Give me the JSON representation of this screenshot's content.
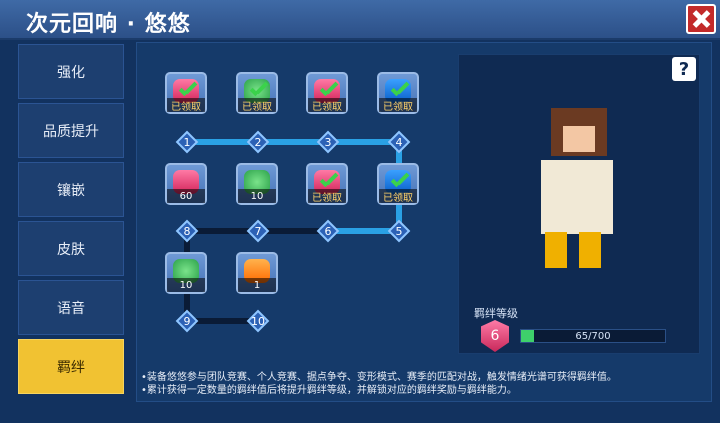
{
  "window": {
    "title": "次元回响 · 悠悠"
  },
  "sidebar": {
    "items": [
      {
        "label": "强化"
      },
      {
        "label": "品质提升"
      },
      {
        "label": "镶嵌"
      },
      {
        "label": "皮肤"
      },
      {
        "label": "语音"
      },
      {
        "label": "羁绊",
        "active": true
      }
    ]
  },
  "rewards": [
    {
      "type": "gem",
      "badge": "已领取",
      "claimed": true
    },
    {
      "type": "clover",
      "badge": "已领取",
      "claimed": true
    },
    {
      "type": "gem",
      "badge": "已领取",
      "claimed": true
    },
    {
      "type": "chest",
      "badge": "已领取",
      "claimed": true
    },
    {
      "type": "gem",
      "badge": "60",
      "claimed": false
    },
    {
      "type": "clover",
      "badge": "10",
      "claimed": false
    },
    {
      "type": "gem",
      "badge": "已领取",
      "claimed": true
    },
    {
      "type": "chest",
      "badge": "已领取",
      "claimed": true
    },
    {
      "type": "clover",
      "badge": "10",
      "claimed": false
    },
    {
      "type": "gift",
      "badge": "1",
      "claimed": false
    }
  ],
  "nodes": [
    "1",
    "2",
    "3",
    "4",
    "5",
    "6",
    "7",
    "8",
    "9",
    "10"
  ],
  "help_button": {
    "label": "?"
  },
  "bond": {
    "title": "羁绊等级",
    "level": "6",
    "progress_text": "65/700",
    "progress_value": 0.093
  },
  "notes": [
    "•装备悠悠参与团队竞赛、个人竞赛、据点争夺、变形模式、赛季的匹配对战，触发情绪光谱可获得羁绊值。",
    "•累计获得一定数量的羁绊值后将提升羁绊等级，并解锁对应的羁绊奖励与羁绊能力。"
  ]
}
